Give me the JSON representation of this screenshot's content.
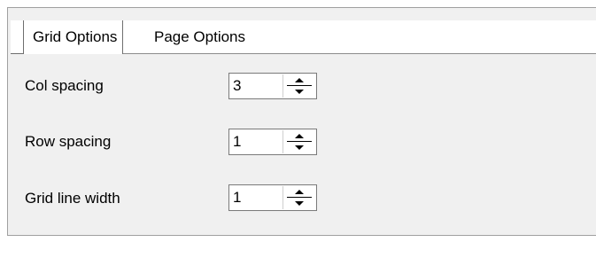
{
  "tabs": [
    {
      "label": "Grid Options",
      "selected": true
    },
    {
      "label": "Page Options",
      "selected": false
    }
  ],
  "fields": [
    {
      "label": "Col spacing",
      "value": "3"
    },
    {
      "label": "Row spacing",
      "value": "1"
    },
    {
      "label": "Grid line width",
      "value": "1"
    }
  ],
  "icons": {
    "spin_up": "arrow-up-icon",
    "spin_down": "arrow-down-icon"
  },
  "colors": {
    "panel_background": "#f0f0f0",
    "input_background": "#ffffff",
    "border": "#7a7a7a"
  }
}
